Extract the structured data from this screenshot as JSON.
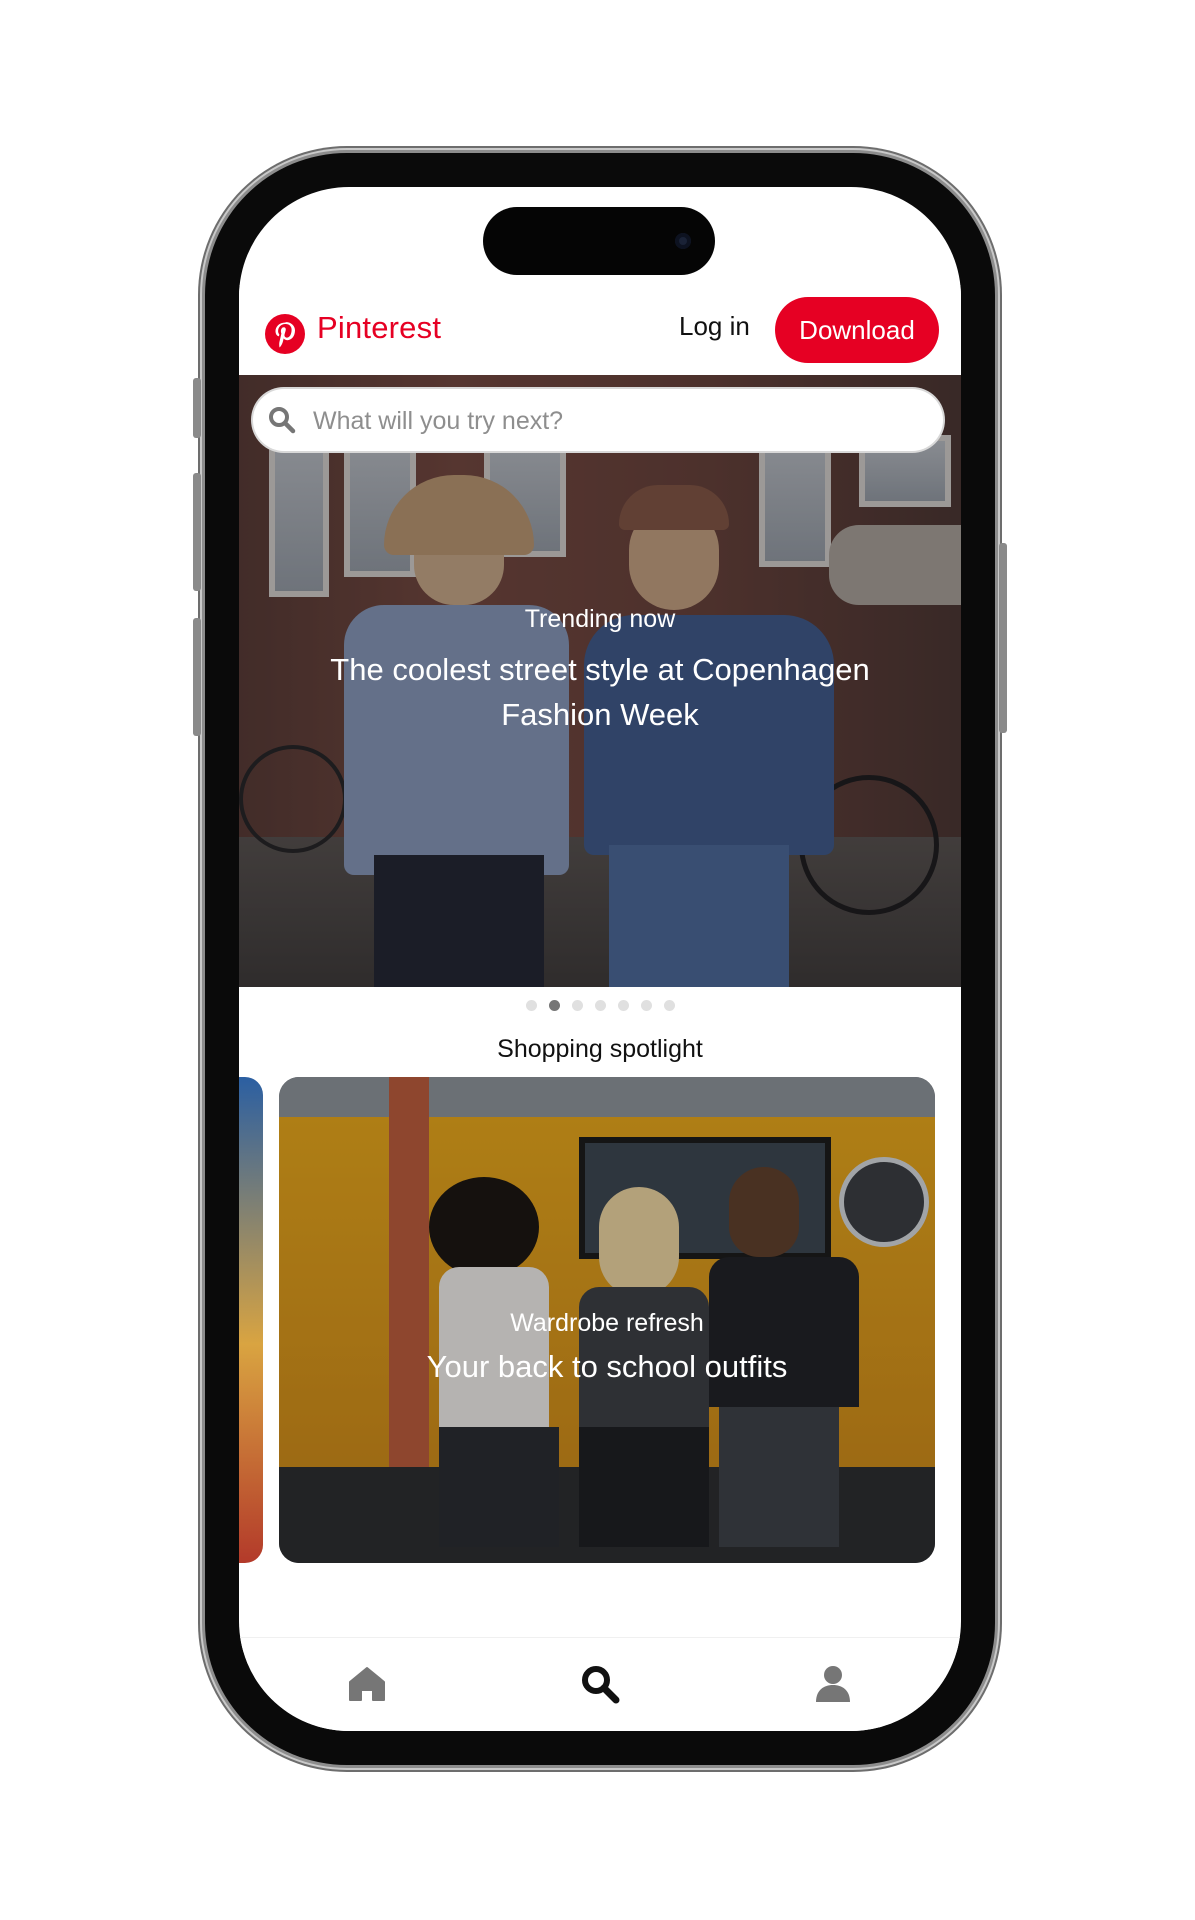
{
  "header": {
    "brand": "Pinterest",
    "login_label": "Log in",
    "download_label": "Download"
  },
  "search": {
    "placeholder": "What will you try next?"
  },
  "hero": {
    "kicker": "Trending now",
    "title": "The coolest street style at Copenhagen Fashion Week",
    "carousel": {
      "total": 7,
      "active_index": 1
    }
  },
  "spotlight": {
    "section_title": "Shopping spotlight",
    "card": {
      "kicker": "Wardrobe refresh",
      "title": "Your back to school outfits"
    }
  },
  "bottom_nav": {
    "items": [
      {
        "icon": "home-icon"
      },
      {
        "icon": "search-icon"
      },
      {
        "icon": "profile-icon"
      }
    ]
  },
  "colors": {
    "brand": "#e60023",
    "text": "#111111",
    "placeholder": "#8e8e8e"
  }
}
